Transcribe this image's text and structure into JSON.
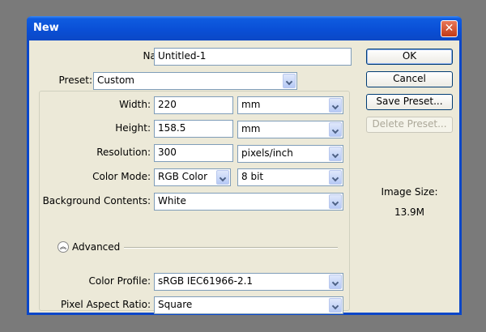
{
  "dialog": {
    "title": "New"
  },
  "form": {
    "name": {
      "label": "Name:",
      "value": "Untitled-1"
    },
    "preset": {
      "label": "Preset:",
      "value": "Custom"
    },
    "width": {
      "label": "Width:",
      "value": "220",
      "unit": "mm"
    },
    "height": {
      "label": "Height:",
      "value": "158.5",
      "unit": "mm"
    },
    "resolution": {
      "label": "Resolution:",
      "value": "300",
      "unit": "pixels/inch"
    },
    "color_mode": {
      "label": "Color Mode:",
      "value": "RGB Color",
      "depth": "8 bit"
    },
    "background": {
      "label": "Background Contents:",
      "value": "White"
    },
    "advanced": {
      "label": "Advanced"
    },
    "color_profile": {
      "label": "Color Profile:",
      "value": "sRGB IEC61966-2.1"
    },
    "pixel_aspect": {
      "label": "Pixel Aspect Ratio:",
      "value": "Square"
    }
  },
  "buttons": {
    "ok": "OK",
    "cancel": "Cancel",
    "save_preset": "Save Preset...",
    "delete_preset": "Delete Preset..."
  },
  "image_size": {
    "label": "Image Size:",
    "value": "13.9M"
  },
  "icons": {
    "close": "close-icon",
    "dropdown": "chevron-down-icon",
    "advanced_toggle": "chevron-up-icon"
  },
  "colors": {
    "titlebar": "#0a4fd6",
    "close_button": "#d9552f",
    "dialog_bg": "#ece9d8",
    "field_border": "#7f9db9"
  }
}
